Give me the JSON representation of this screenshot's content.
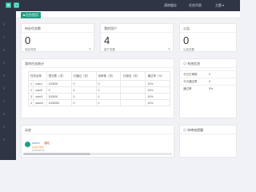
{
  "topbar": {
    "links": [
      "清除缓存",
      "任务列表",
      "主题"
    ]
  },
  "tab": {
    "label": "后台首页"
  },
  "stats": [
    {
      "title": "待办任务数",
      "value": "0",
      "sub": "待办任务",
      "unit": "个"
    },
    {
      "title": "我的用户",
      "value": "4",
      "sub": "用户总数",
      "unit": "个"
    },
    {
      "title": "公告",
      "value": "0",
      "sub": "公告总数",
      "unit": ""
    }
  ],
  "task_table": {
    "title": "我的任务统计",
    "headers": [
      "任务名称",
      "提交数（次）",
      "已通过（次）",
      "待审核（次）",
      "已驳回（次）",
      "通过率（%）"
    ],
    "rows": [
      [
        "1",
        "user1",
        "100000",
        "0",
        "0",
        "10%"
      ],
      [
        "2",
        "user2",
        "0",
        "0",
        "0",
        "10%"
      ],
      [
        "3",
        "user3",
        "100000",
        "0",
        "0",
        "10%"
      ],
      [
        "4",
        "admin",
        "1000000",
        "0",
        "0",
        "10%"
      ]
    ]
  },
  "system_info": {
    "title": "系统信息",
    "rows": [
      {
        "label": "今日已审核",
        "value": "0"
      },
      {
        "label": "今日通过率",
        "value": "0"
      },
      {
        "label": "通过率",
        "value": "0%"
      }
    ]
  },
  "dynamics": {
    "title": "动态",
    "user": "admin",
    "tag": "通知",
    "text": "系统已更新",
    "time": "2018-08-18"
  },
  "pending": {
    "title": "待审核提醒"
  },
  "colors": {
    "accent": "#1f9e84",
    "sidebar": "#2f3544"
  }
}
